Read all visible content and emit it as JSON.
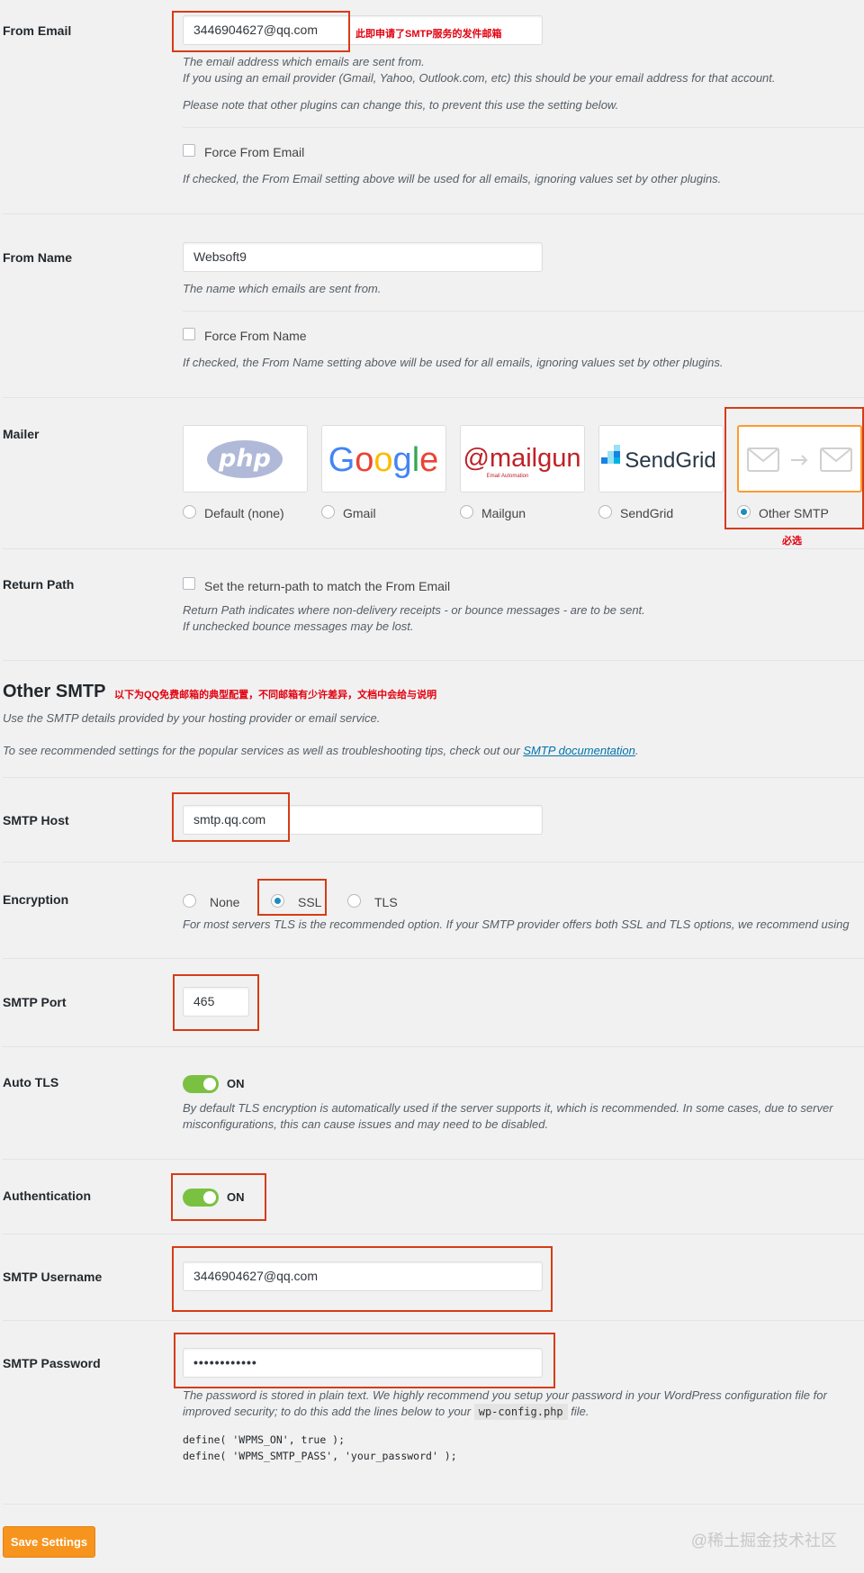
{
  "from_email": {
    "label": "From Email",
    "value": "3446904627@qq.com",
    "annotation": "此即申请了SMTP服务的发件邮箱",
    "desc1": "The email address which emails are sent from.",
    "desc2": "If you using an email provider (Gmail, Yahoo, Outlook.com, etc) this should be your email address for that account.",
    "desc3": "Please note that other plugins can change this, to prevent this use the setting below.",
    "force_label": "Force From Email",
    "force_checked": false,
    "force_desc": "If checked, the From Email setting above will be used for all emails, ignoring values set by other plugins."
  },
  "from_name": {
    "label": "From Name",
    "value": "Websoft9",
    "desc": "The name which emails are sent from.",
    "force_label": "Force From Name",
    "force_checked": false,
    "force_desc": "If checked, the From Name setting above will be used for all emails, ignoring values set by other plugins."
  },
  "mailer": {
    "label": "Mailer",
    "options": [
      {
        "label": "Default (none)",
        "logo": "php",
        "selected": false
      },
      {
        "label": "Gmail",
        "logo": "Google",
        "selected": false
      },
      {
        "label": "Mailgun",
        "logo": "mailgun",
        "logo_sub": "Email Automation",
        "selected": false
      },
      {
        "label": "SendGrid",
        "logo": "SendGrid",
        "selected": false
      },
      {
        "label": "Other SMTP",
        "logo": "envelope-arrow-envelope",
        "selected": true
      }
    ],
    "annotation": "必选"
  },
  "return_path": {
    "label": "Return Path",
    "checkbox_label": "Set the return-path to match the From Email",
    "checked": false,
    "desc1": "Return Path indicates where non-delivery receipts - or bounce messages - are to be sent.",
    "desc2": "If unchecked bounce messages may be lost."
  },
  "other_smtp": {
    "heading": "Other SMTP",
    "annotation": "以下为QQ免费邮箱的典型配置，不同邮箱有少许差异，文档中会给与说明",
    "desc1": "Use the SMTP details provided by your hosting provider or email service.",
    "desc2_prefix": "To see recommended settings for the popular services as well as troubleshooting tips, check out our ",
    "desc2_link": "SMTP documentation",
    "desc2_suffix": "."
  },
  "smtp_host": {
    "label": "SMTP Host",
    "value": "smtp.qq.com"
  },
  "encryption": {
    "label": "Encryption",
    "options": [
      {
        "label": "None",
        "selected": false
      },
      {
        "label": "SSL",
        "selected": true
      },
      {
        "label": "TLS",
        "selected": false
      }
    ],
    "desc": "For most servers TLS is the recommended option. If your SMTP provider offers both SSL and TLS options, we recommend using"
  },
  "smtp_port": {
    "label": "SMTP Port",
    "value": "465"
  },
  "auto_tls": {
    "label": "Auto TLS",
    "state": "ON",
    "desc1": "By default TLS encryption is automatically used if the server supports it, which is recommended. In some cases, due to server",
    "desc2": "misconfigurations, this can cause issues and may need to be disabled."
  },
  "authentication": {
    "label": "Authentication",
    "state": "ON"
  },
  "smtp_username": {
    "label": "SMTP Username",
    "value": "3446904627@qq.com"
  },
  "smtp_password": {
    "label": "SMTP Password",
    "value": "••••••••••••",
    "desc1": "The password is stored in plain text. We highly recommend you setup your password in your WordPress configuration file for",
    "desc2_prefix": "improved security; to do this add the lines below to your ",
    "desc2_code": "wp-config.php",
    "desc2_suffix": " file.",
    "code1": "define( 'WPMS_ON', true );",
    "code2": "define( 'WPMS_SMTP_PASS', 'your_password' );"
  },
  "save_button": "Save Settings",
  "watermark": "@稀土掘金技术社区",
  "colors": {
    "accent": "#ff9a2e",
    "annotation": "#e2000f",
    "toggle_on": "#7ac142",
    "link": "#0073aa",
    "button": "#f7941d"
  }
}
